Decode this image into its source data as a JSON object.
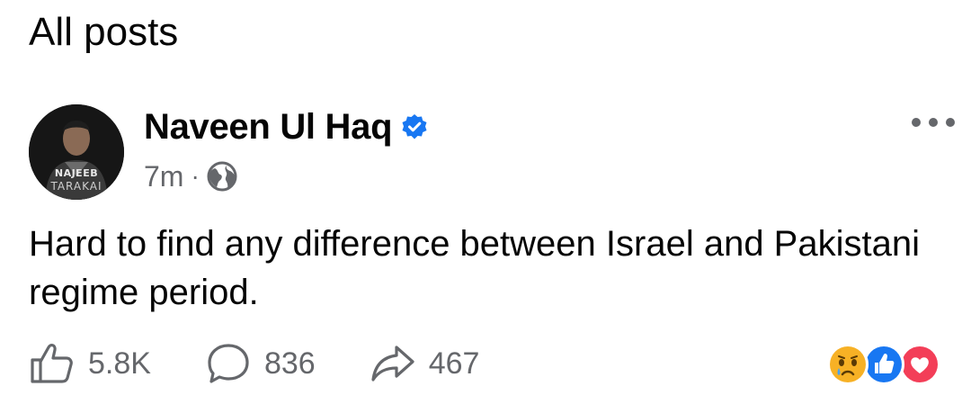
{
  "page": {
    "title": "All posts"
  },
  "post": {
    "author": {
      "name": "Naveen Ul Haq",
      "verified": true,
      "avatar_text": [
        "NAJEEB",
        "TARAKAI"
      ]
    },
    "timestamp": "7m",
    "separator": "·",
    "audience_icon": "globe-icon",
    "text": "Hard to find any difference between Israel and Pakistani regime period.",
    "stats": {
      "likes": "5.8K",
      "comments": "836",
      "shares": "467"
    },
    "reactions": [
      "sad",
      "like",
      "love"
    ]
  },
  "colors": {
    "verified_blue": "#1877f2",
    "secondary_text": "#65676b",
    "like_blue": "#1877f2",
    "love_red": "#f33e58",
    "sad_yellow": "#f7b125"
  }
}
